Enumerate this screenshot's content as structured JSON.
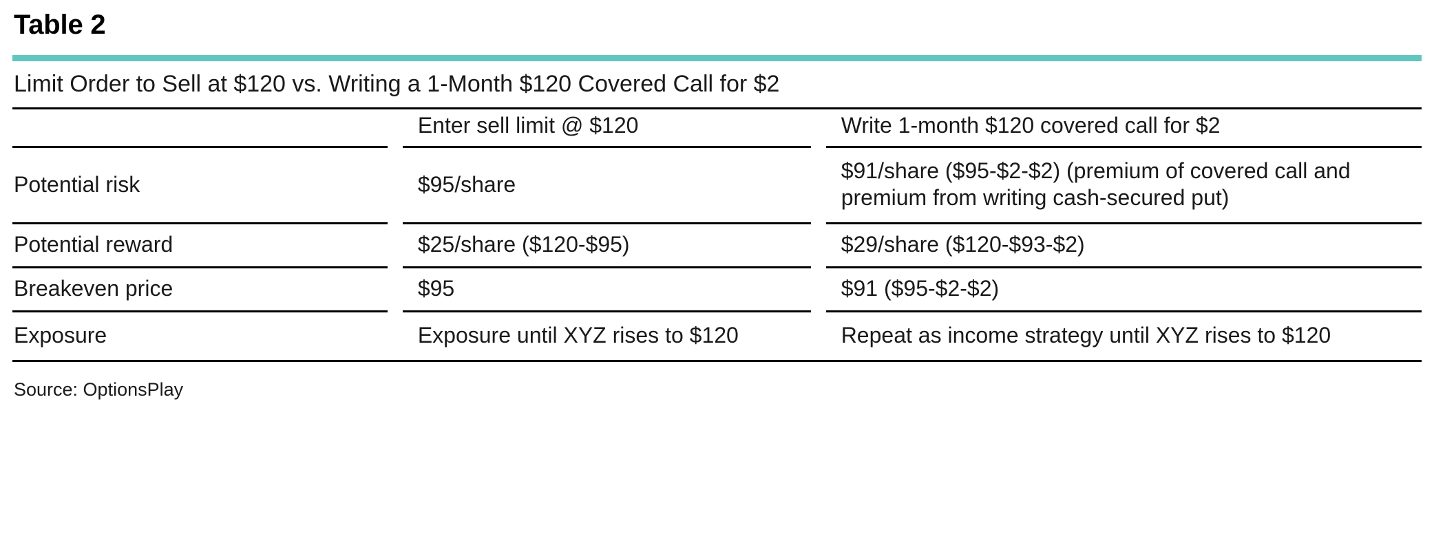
{
  "figure": {
    "title": "Table 2",
    "subtitle": "Limit Order to Sell at $120 vs. Writing a 1-Month $120 Covered Call for $2",
    "accent_color": "#62c6c0",
    "rule_color": "#000000",
    "source": "Source: OptionsPlay"
  },
  "table": {
    "headers": {
      "label": "",
      "limit_order": "Enter sell limit @ $120",
      "covered_call": "Write 1-month $120 covered call for $2"
    },
    "rows": [
      {
        "label": "Potential risk",
        "limit_order": "$95/share",
        "covered_call": "$91/share ($95-$2-$2) (premium of covered call and premium from writing cash-secured put)"
      },
      {
        "label": "Potential reward",
        "limit_order": "$25/share ($120-$95)",
        "covered_call": "$29/share ($120-$93-$2)"
      },
      {
        "label": "Breakeven price",
        "limit_order": "$95",
        "covered_call": "$91 ($95-$2-$2)"
      },
      {
        "label": "Exposure",
        "limit_order": "Exposure until XYZ rises to $120",
        "covered_call": "Repeat as income strategy until XYZ rises to $120"
      }
    ]
  }
}
